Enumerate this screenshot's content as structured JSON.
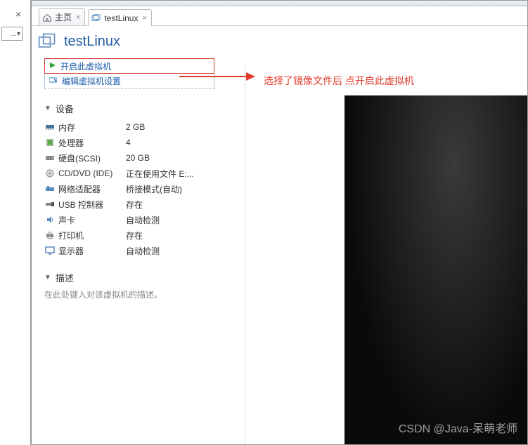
{
  "tabs": {
    "home": "主页",
    "vm": "testLinux"
  },
  "title": "testLinux",
  "actions": {
    "power_on": "开启此虚拟机",
    "edit_settings": "编辑虚拟机设置"
  },
  "annotation": "选择了镜像文件后 点开启此虚拟机",
  "sections": {
    "devices": "设备",
    "description": "描述"
  },
  "devices": [
    {
      "icon": "memory",
      "label": "内存",
      "value": "2 GB"
    },
    {
      "icon": "cpu",
      "label": "处理器",
      "value": "4"
    },
    {
      "icon": "disk",
      "label": "硬盘(SCSI)",
      "value": "20 GB"
    },
    {
      "icon": "cd",
      "label": "CD/DVD (IDE)",
      "value": "正在使用文件 E:..."
    },
    {
      "icon": "nic",
      "label": "网络适配器",
      "value": "桥接模式(自动)"
    },
    {
      "icon": "usb",
      "label": "USB 控制器",
      "value": "存在"
    },
    {
      "icon": "sound",
      "label": "声卡",
      "value": "自动检测"
    },
    {
      "icon": "printer",
      "label": "打印机",
      "value": "存在"
    },
    {
      "icon": "display",
      "label": "显示器",
      "value": "自动检测"
    }
  ],
  "description_placeholder": "在此处键入对该虚拟机的描述。",
  "watermark": "CSDN @Java-呆萌老师",
  "left_dropdown": "..."
}
